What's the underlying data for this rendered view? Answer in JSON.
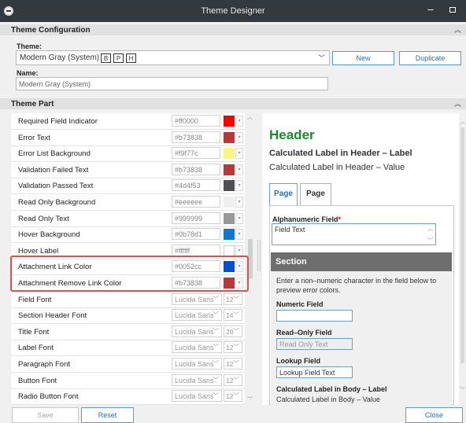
{
  "window": {
    "title": "Theme Designer",
    "minimize": "–"
  },
  "config": {
    "section_title": "Theme Configuration",
    "theme_label": "Theme:",
    "theme_value": "Modern Gray (System)",
    "badges": [
      "B",
      "P",
      "H"
    ],
    "new_label": "New",
    "duplicate_label": "Duplicate",
    "name_label": "Name:",
    "name_value": "Modern Gray (System)"
  },
  "theme_part": {
    "section_title": "Theme Part",
    "color_rows": [
      {
        "name": "Required Field Indicator",
        "hex": "#ff0000",
        "swatch": "#ff0000"
      },
      {
        "name": "Error Text",
        "hex": "#b73838",
        "swatch": "#b73838"
      },
      {
        "name": "Error List Background",
        "hex": "#f9f77c",
        "swatch": "#f9f77c"
      },
      {
        "name": "Validation Failed Text",
        "hex": "#b73838",
        "swatch": "#b73838"
      },
      {
        "name": "Validation Passed Text",
        "hex": "#4d4f53",
        "swatch": "#4d4f53"
      },
      {
        "name": "Read Only Background",
        "hex": "#eeeeee",
        "swatch": "#eeeeee"
      },
      {
        "name": "Read Only Text",
        "hex": "#999999",
        "swatch": "#999999"
      },
      {
        "name": "Hover Background",
        "hex": "#0b78d1",
        "swatch": "#0b78d1"
      },
      {
        "name": "Hover Label",
        "hex": "#ffffff",
        "swatch": "#ffffff"
      },
      {
        "name": "Attachment Link Color",
        "hex": "#0052cc",
        "swatch": "#0052cc"
      },
      {
        "name": "Attachment Remove Link Color",
        "hex": "#b73838",
        "swatch": "#b73838"
      }
    ],
    "font_rows": [
      {
        "name": "Field Font",
        "font": "Lucida Sans",
        "size": "12"
      },
      {
        "name": "Section Header Font",
        "font": "Lucida Sans",
        "size": "14"
      },
      {
        "name": "Title Font",
        "font": "Lucida Sans",
        "size": "20"
      },
      {
        "name": "Label Font",
        "font": "Lucida Sans",
        "size": "12"
      },
      {
        "name": "Paragraph Font",
        "font": "Lucida Sans",
        "size": "12"
      },
      {
        "name": "Button Font",
        "font": "Lucida Sans",
        "size": "12"
      },
      {
        "name": "Radio Button Font",
        "font": "Lucida Sans",
        "size": "12"
      }
    ]
  },
  "preview": {
    "header": "Header",
    "calc_label": "Calculated Label in Header – Label",
    "calc_value": "Calculated Label in Header – Value",
    "tabs": [
      "Page",
      "Page"
    ],
    "alpha_label": "Alphanumeric Field",
    "alpha_value": "Field Text",
    "section_header": "Section",
    "section_desc": "Enter a non–numeric character in the field below to preview error colors.",
    "numeric_label": "Numeric Field",
    "readonly_label": "Read–Only Field",
    "readonly_value": "Read Only Text",
    "lookup_label": "Lookup Field",
    "lookup_value": "Lookup Field Text",
    "calc_body_label": "Calculated Label in Body – Label",
    "calc_body_value": "Calculated Label in Body – Value"
  },
  "footer": {
    "save": "Save",
    "reset": "Reset",
    "close": "Close"
  },
  "colors": {
    "titlebar": "#333a3f",
    "accent": "#2a6ebb",
    "header_green": "#1a8a2a",
    "highlight": "#e0504a"
  }
}
